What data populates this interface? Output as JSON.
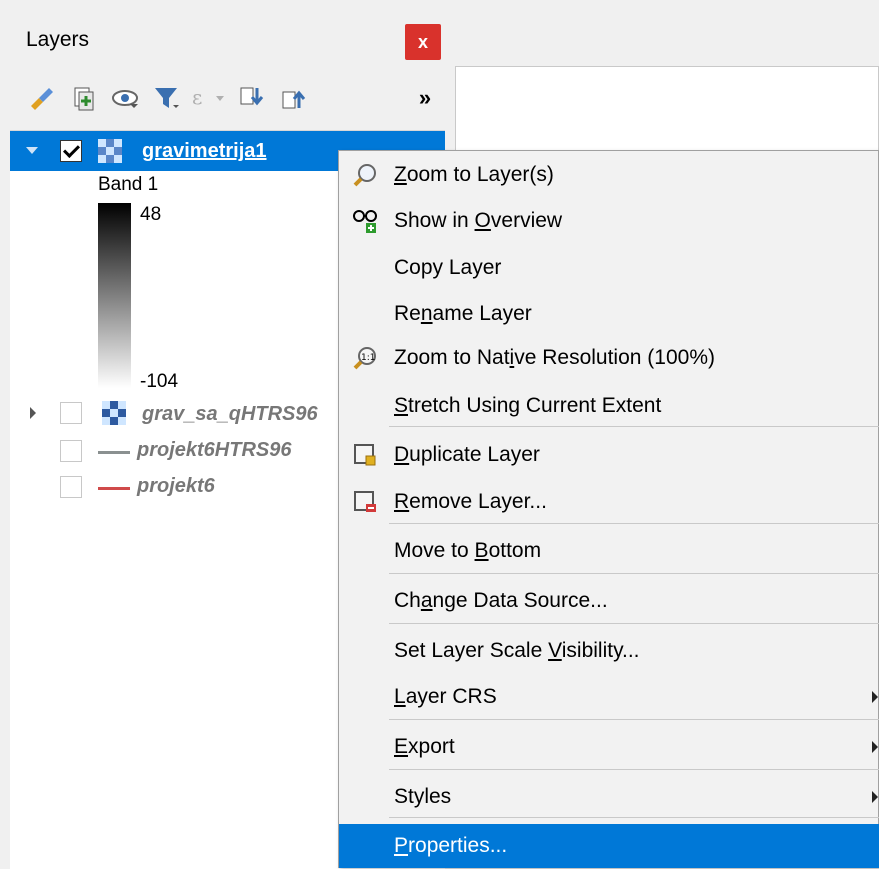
{
  "panel": {
    "title": "Layers",
    "close_label": "x",
    "toolbar_more": "»"
  },
  "layers": [
    {
      "name": "gravimetrija1",
      "checked": true,
      "selected": true,
      "expanded": true,
      "legend": {
        "band": "Band 1",
        "max": "48",
        "min": "-104"
      }
    },
    {
      "name": "grav_sa_qHTRS96",
      "checked": false,
      "selected": false
    },
    {
      "name": "projekt6HTRS96",
      "checked": false,
      "selected": false,
      "line_color": "#8a9090"
    },
    {
      "name": "projekt6",
      "checked": false,
      "selected": false,
      "line_color": "#d04a4a"
    }
  ],
  "menu": {
    "items": [
      {
        "pre": "",
        "ul": "Z",
        "post": "oom to Layer(s)",
        "icon": "zoom-layer-icon"
      },
      {
        "pre": "Show in ",
        "ul": "O",
        "post": "verview",
        "icon": "show-overview-icon"
      },
      {
        "pre": "Copy Layer",
        "ul": "",
        "post": "",
        "icon": ""
      },
      {
        "pre": "Re",
        "ul": "n",
        "post": "ame Layer",
        "icon": ""
      },
      {
        "pre": "Zoom to Nat",
        "ul": "i",
        "post": "ve Resolution (100%)",
        "icon": "zoom-native-icon"
      },
      {
        "pre": "",
        "ul": "S",
        "post": "tretch Using Current Extent",
        "icon": ""
      },
      {
        "pre": "",
        "ul": "D",
        "post": "uplicate Layer",
        "icon": "duplicate-layer-icon"
      },
      {
        "pre": "",
        "ul": "R",
        "post": "emove Layer...",
        "icon": "remove-layer-icon"
      },
      {
        "pre": "Move to ",
        "ul": "B",
        "post": "ottom",
        "icon": ""
      },
      {
        "pre": "Ch",
        "ul": "a",
        "post": "nge Data Source...",
        "icon": ""
      },
      {
        "pre": "Set Layer Scale ",
        "ul": "V",
        "post": "isibility...",
        "icon": ""
      },
      {
        "pre": "",
        "ul": "L",
        "post": "ayer CRS",
        "icon": "",
        "submenu": true
      },
      {
        "pre": "",
        "ul": "E",
        "post": "xport",
        "icon": "",
        "submenu": true
      },
      {
        "pre": "Styles",
        "ul": "",
        "post": "",
        "icon": "",
        "submenu": true
      },
      {
        "pre": "",
        "ul": "P",
        "post": "roperties...",
        "icon": "",
        "active": true
      }
    ]
  },
  "colors": {
    "selection": "#0078d7",
    "close_button": "#d9322c"
  }
}
